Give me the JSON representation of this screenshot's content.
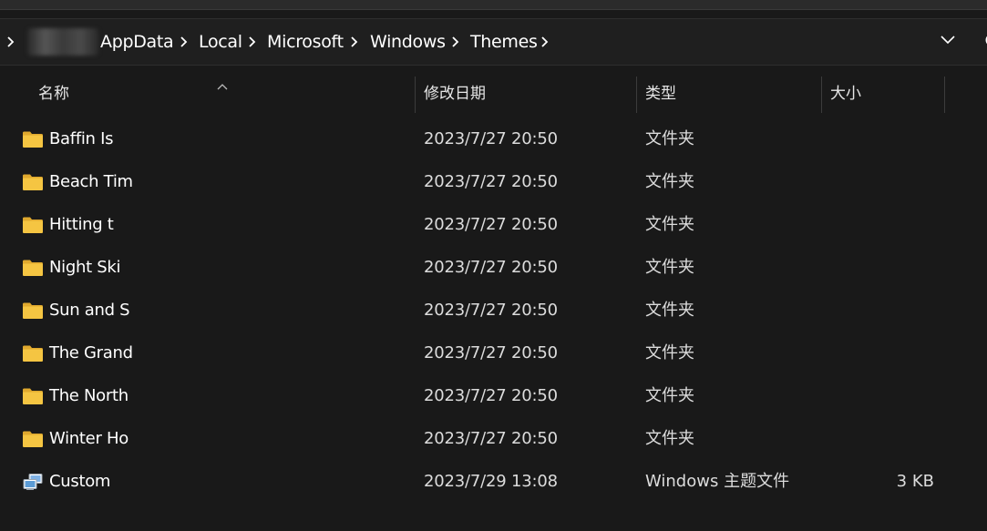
{
  "breadcrumb": {
    "redacted_user": "",
    "items": [
      {
        "label": "AppData"
      },
      {
        "label": "Local"
      },
      {
        "label": "Microsoft"
      },
      {
        "label": "Windows"
      },
      {
        "label": "Themes"
      }
    ]
  },
  "columns": {
    "name": "名称",
    "date": "修改日期",
    "type": "类型",
    "size": "大小"
  },
  "files": [
    {
      "name": "Baffin Is",
      "date": "2023/7/27 20:50",
      "type": "文件夹",
      "size": "",
      "icon": "folder-icon"
    },
    {
      "name": "Beach Tim",
      "date": "2023/7/27 20:50",
      "type": "文件夹",
      "size": "",
      "icon": "folder-icon"
    },
    {
      "name": "Hitting t",
      "date": "2023/7/27 20:50",
      "type": "文件夹",
      "size": "",
      "icon": "folder-icon",
      "selected": true
    },
    {
      "name": "Night Ski",
      "date": "2023/7/27 20:50",
      "type": "文件夹",
      "size": "",
      "icon": "folder-icon"
    },
    {
      "name": "Sun and S",
      "date": "2023/7/27 20:50",
      "type": "文件夹",
      "size": "",
      "icon": "folder-icon"
    },
    {
      "name": "The Grand",
      "date": "2023/7/27 20:50",
      "type": "文件夹",
      "size": "",
      "icon": "folder-icon"
    },
    {
      "name": "The North",
      "date": "2023/7/27 20:50",
      "type": "文件夹",
      "size": "",
      "icon": "folder-icon"
    },
    {
      "name": "Winter Ho",
      "date": "2023/7/27 20:50",
      "type": "文件夹",
      "size": "",
      "icon": "folder-icon"
    },
    {
      "name": "Custom",
      "date": "2023/7/29 13:08",
      "type": "Windows 主题文件",
      "size": "3 KB",
      "icon": "theme-file-icon"
    }
  ],
  "colors": {
    "background": "#191919",
    "selection": "#4a4a4a",
    "folder": "#f5c542"
  }
}
